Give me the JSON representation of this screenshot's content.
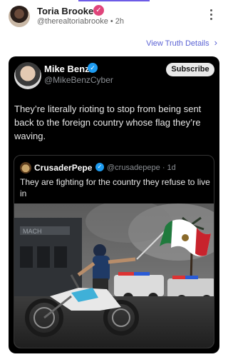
{
  "post": {
    "author_name": "Toria Brooke",
    "author_handle": "@therealtoriabrooke",
    "time_ago": "2h",
    "handle_time": "@therealtoriabrooke • 2h",
    "verified_icon": "verified-badge-icon",
    "menu_icon": "more-vertical-icon"
  },
  "view_details": {
    "label": "View Truth Details",
    "chevron": "›"
  },
  "embedded_post": {
    "author_name": "Mike Benz",
    "author_handle": "@MikeBenzCyber",
    "subscribe_label": "Subscribe",
    "text": "They’re literally rioting to stop from being sent back to the foreign country whose flag they’re waving.",
    "verified_icon": "verified-badge-icon"
  },
  "quoted_post": {
    "author_name": "CrusaderPepe",
    "handle_time": "@crusadepepe · 1d",
    "text": "They are fighting for the country they refuse to live in",
    "image_subject": "man on dirt bike waving Mexican flag"
  },
  "colors": {
    "accent": "#5b63d4",
    "verified_pink": "#e0457b",
    "verified_blue": "#1d9bf0",
    "card_bg": "#000000"
  }
}
